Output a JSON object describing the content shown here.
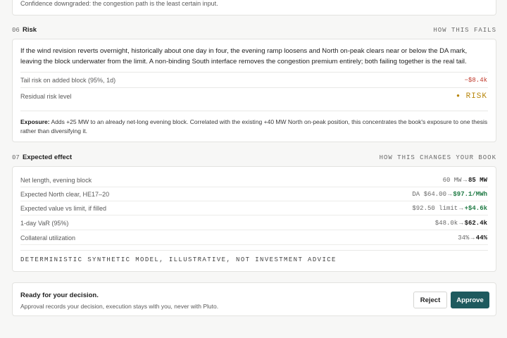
{
  "top_note": "Confidence downgraded: the congestion path is the least certain input.",
  "risk_section": {
    "number": "06",
    "title": "Risk",
    "right_label": "HOW THIS FAILS",
    "paragraph": "If the wind revision reverts overnight, historically about one day in four, the evening ramp loosens and North on-peak clears near or below the DA mark, leaving the block underwater from the limit. A non-binding South interface removes the congestion premium entirely; both failing together is the real tail.",
    "tail_risk_label": "Tail risk on added block (95%, 1d)",
    "tail_risk_value": "−$8.4k",
    "residual_label": "Residual risk level",
    "residual_value": "RISK",
    "residual_icon": "dot-icon",
    "exposure_label": "Exposure:",
    "exposure_text": "Adds +25 MW to an already net-long evening block. Correlated with the existing +40 MW North on-peak position, this concentrates the book's exposure to one thesis rather than diversifying it."
  },
  "effect_section": {
    "number": "07",
    "title": "Expected effect",
    "right_label": "HOW THIS CHANGES YOUR BOOK",
    "rows": [
      {
        "label": "Net length, evening block",
        "before": "60 MW",
        "arrow": "→",
        "after": "85 MW",
        "after_color": "#1a1a1a"
      },
      {
        "label": "Expected North clear, HE17–20",
        "before": "DA $64.00",
        "arrow": "→",
        "after": "$97.1/MWh",
        "after_color": "#1f7a44"
      },
      {
        "label": "Expected value vs limit, if filled",
        "before": "$92.50 limit",
        "arrow": "→",
        "after": "+$4.6k",
        "after_color": "#1f7a44"
      },
      {
        "label": "1-day VaR (95%)",
        "before": "$48.0k",
        "arrow": "→",
        "after": "$62.4k",
        "after_color": "#1a1a1a"
      },
      {
        "label": "Collateral utilization",
        "before": "34%",
        "arrow": "→",
        "after": "44%",
        "after_color": "#1a1a1a"
      }
    ],
    "disclaimer": "DETERMINISTIC SYNTHETIC MODEL, ILLUSTRATIVE, NOT INVESTMENT ADVICE"
  },
  "decision": {
    "title": "Ready for your decision.",
    "subtitle": "Approval records your decision, execution stays with you, never with Pluto.",
    "reject_label": "Reject",
    "approve_label": "Approve"
  },
  "colors": {
    "accent": "#1e5a5e",
    "negative": "#c0392b",
    "positive": "#1f7a44",
    "risk": "#b8860b"
  }
}
